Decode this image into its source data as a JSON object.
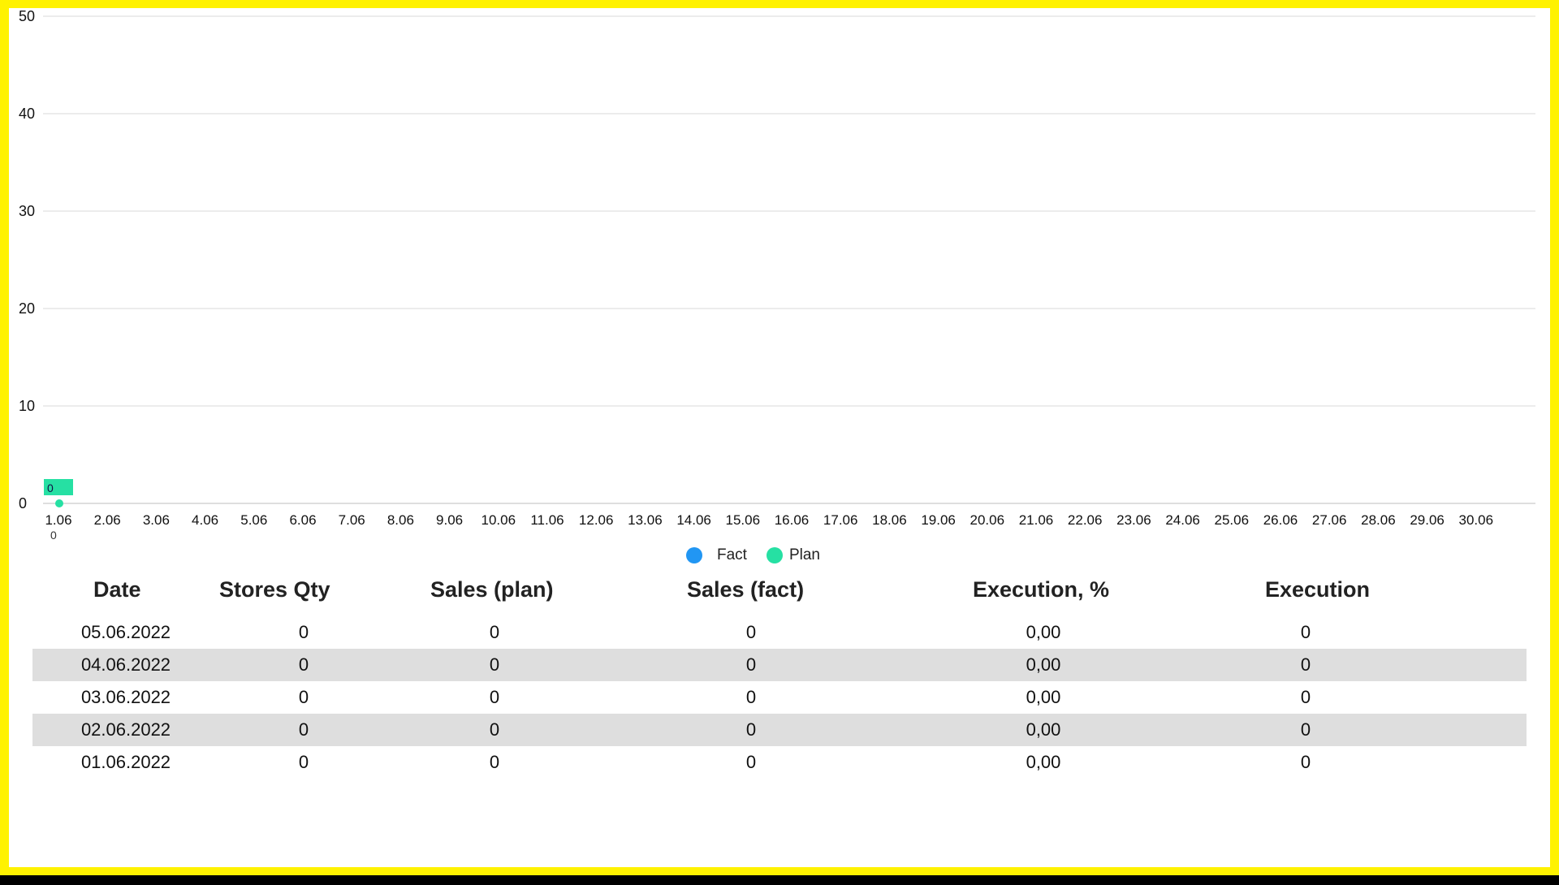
{
  "chart_data": {
    "type": "bar",
    "y_ticks": [
      0,
      10,
      20,
      30,
      40,
      50
    ],
    "ylim": [
      0,
      50
    ],
    "categories": [
      "1.06",
      "2.06",
      "3.06",
      "4.06",
      "5.06",
      "6.06",
      "7.06",
      "8.06",
      "9.06",
      "10.06",
      "11.06",
      "12.06",
      "13.06",
      "14.06",
      "15.06",
      "16.06",
      "17.06",
      "18.06",
      "19.06",
      "20.06",
      "21.06",
      "22.06",
      "23.06",
      "24.06",
      "25.06",
      "26.06",
      "27.06",
      "28.06",
      "29.06",
      "30.06"
    ],
    "series": [
      {
        "name": "Fact",
        "kind": "scatter",
        "color": "#2196f3",
        "points": [
          {
            "category": "1.06",
            "value": 0
          }
        ],
        "label": "0"
      },
      {
        "name": "Plan",
        "kind": "bar",
        "color": "#26e0a3",
        "points": [
          {
            "category": "1.06",
            "value": 0
          }
        ],
        "label": "0"
      }
    ],
    "grid": true,
    "legend_position": "bottom-center"
  },
  "legend": [
    {
      "label": "Fact",
      "color": "#2196f3"
    },
    {
      "label": "Plan",
      "color": "#26e0a3"
    }
  ],
  "table": {
    "columns": [
      "Date",
      "Stores Qty",
      "Sales (plan)",
      "Sales (fact)",
      "Execution, %",
      "Execution"
    ],
    "rows": [
      [
        "05.06.2022",
        "0",
        "0",
        "0",
        "0,00",
        "0"
      ],
      [
        "04.06.2022",
        "0",
        "0",
        "0",
        "0,00",
        "0"
      ],
      [
        "03.06.2022",
        "0",
        "0",
        "0",
        "0,00",
        "0"
      ],
      [
        "02.06.2022",
        "0",
        "0",
        "0",
        "0,00",
        "0"
      ],
      [
        "01.06.2022",
        "0",
        "0",
        "0",
        "0,00",
        "0"
      ]
    ]
  }
}
